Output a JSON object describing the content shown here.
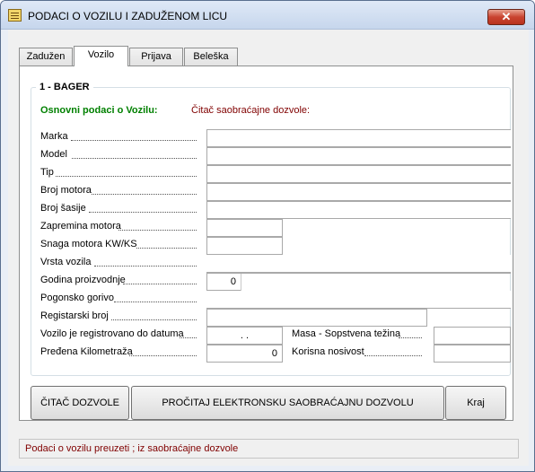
{
  "window": {
    "title": "PODACI O VOZILU I ZADUŽENOM LICU",
    "close_glyph": "✕"
  },
  "tabs": [
    {
      "label": "Zadužen"
    },
    {
      "label": "Vozilo"
    },
    {
      "label": "Prijava"
    },
    {
      "label": "Beleška"
    }
  ],
  "group": {
    "title": "1 - BAGER"
  },
  "sections": {
    "basic": "Osnovni podaci o Vozilu:",
    "reader": "Čitač saobraćajne dozvole:"
  },
  "fields": {
    "marka": {
      "label": "Marka",
      "value": ""
    },
    "model": {
      "label": "Model",
      "value": ""
    },
    "tip": {
      "label": "Tip",
      "value": ""
    },
    "broj_motora": {
      "label": "Broj motora",
      "value": ""
    },
    "broj_sasije": {
      "label": "Broj šasije",
      "value": ""
    },
    "zapremina": {
      "label": "Zapremina motora",
      "value": ""
    },
    "snaga": {
      "label": "Snaga motora KW/KS",
      "value": ""
    },
    "vrsta": {
      "label": "Vrsta vozila",
      "value": ""
    },
    "godina": {
      "label": "Godina proizvodnje",
      "value": "0"
    },
    "gorivo": {
      "label": "Pogonsko gorivo",
      "value": ""
    },
    "registarski": {
      "label": "Registarski broj",
      "value": ""
    },
    "registrovano": {
      "label": "Vozilo je registrovano do datuma",
      "value": ".      ."
    },
    "kilometraza": {
      "label": "Pređena Kilometraža",
      "value": "0"
    },
    "masa": {
      "label": "Masa - Sopstvena težina",
      "value": ""
    },
    "nosivost": {
      "label": "Korisna nosivost",
      "value": ""
    }
  },
  "buttons": {
    "citac": "ČITAČ DOZVOLE",
    "procitaj": "PROČITAJ ELEKTRONSKU SAOBRAĆAJNU DOZVOLU",
    "kraj": "Kraj"
  },
  "status": "Podaci o vozilu preuzeti ; iz saobraćajne dozvole"
}
